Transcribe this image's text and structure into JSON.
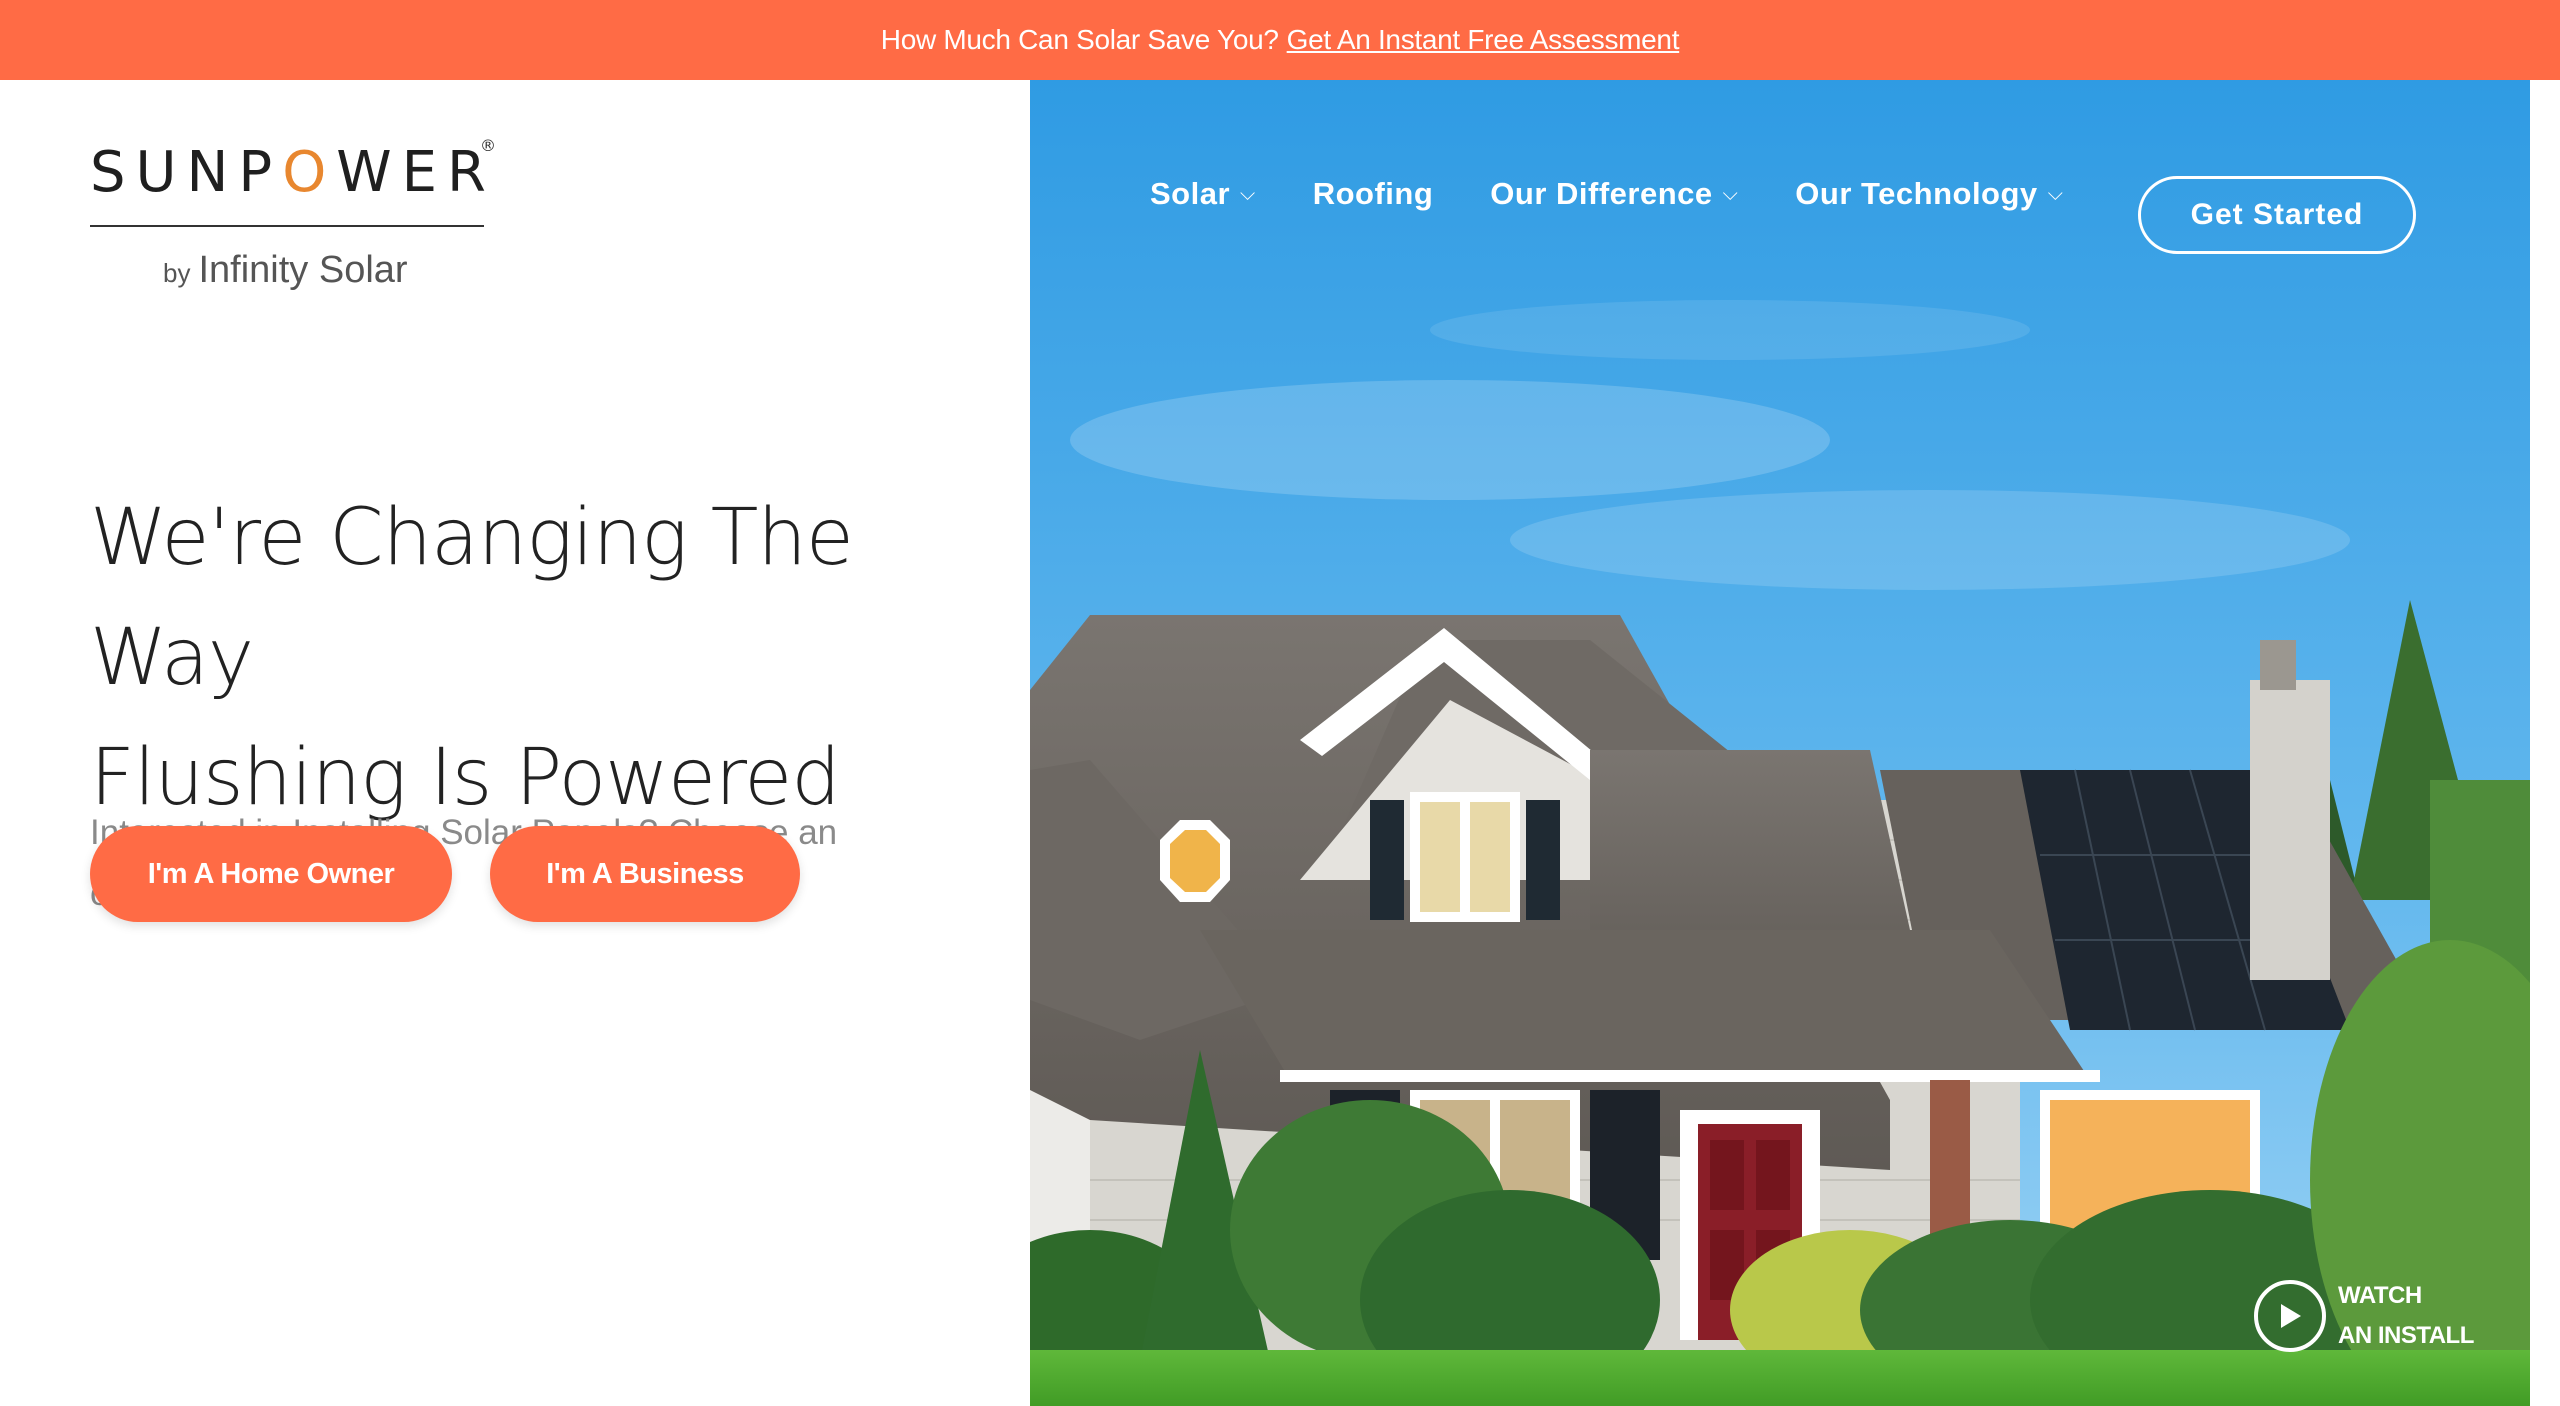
{
  "promo": {
    "text": "How Much Can Solar Save You?",
    "link": "Get An Instant Free Assessment"
  },
  "logo": {
    "brand_pre": "SUNP",
    "brand_o": "O",
    "brand_post": "WER",
    "registered": "®",
    "by": "by",
    "company": "Infinity Solar"
  },
  "hero": {
    "headline_line1": "We're Changing The Way",
    "headline_line2": "Flushing Is Powered",
    "subtext": "Interested in Installing Solar Panels? Choose an option below",
    "buttons": {
      "home_owner": "I'm A Home Owner",
      "business": "I'm A Business"
    }
  },
  "nav": {
    "items": [
      {
        "label": "Solar",
        "dropdown": true
      },
      {
        "label": "Roofing",
        "dropdown": false
      },
      {
        "label": "Our Difference",
        "dropdown": true
      },
      {
        "label": "Our Technology",
        "dropdown": true
      }
    ],
    "cta": "Get Started",
    "chevron": "⌵"
  },
  "watch": {
    "line1": "WATCH",
    "line2": "AN INSTALL"
  },
  "colors": {
    "accent": "#ff6b45",
    "logo_o": "#e8872f",
    "sky": "#3fa4e6"
  }
}
